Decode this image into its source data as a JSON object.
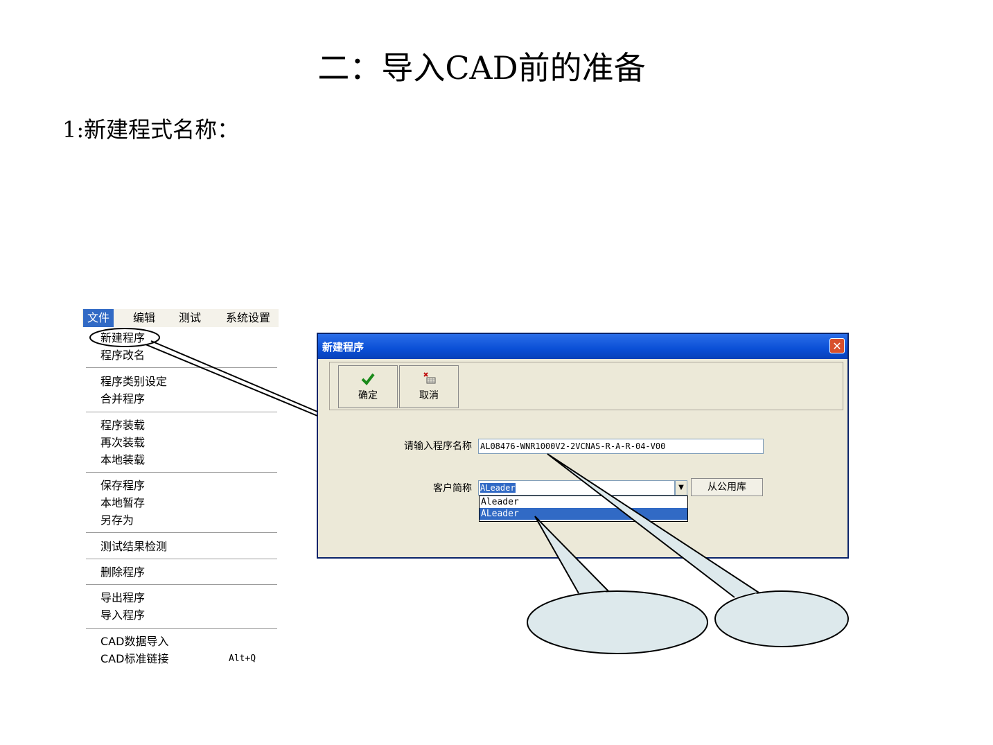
{
  "slide": {
    "title": "二：导入CAD前的准备",
    "subtitle": "1:新建程式名称："
  },
  "menu": {
    "bar": [
      "文件",
      "编辑",
      "测试",
      "系统设置"
    ],
    "active_index": 0,
    "items": [
      "新建程序",
      "程序改名",
      "程序类别设定",
      "合并程序",
      "程序装载",
      "再次装载",
      "本地装载",
      "保存程序",
      "本地暂存",
      "另存为",
      "测试结果检测",
      "删除程序",
      "导出程序",
      "导入程序",
      "CAD数据导入",
      "CAD标准链接"
    ],
    "shortcut": "Alt+Q"
  },
  "dialog": {
    "title": "新建程序",
    "close_glyph": "✕",
    "ok_label": "确定",
    "cancel_label": "取消",
    "program_name_label": "请输入程序名称",
    "program_name_value": "AL08476-WNR1000V2-2VCNAS-R-A-R-04-V00",
    "customer_label": "客户简称",
    "customer_value": "ALeader",
    "public_button": "从公用库",
    "dropdown_options": [
      "Aleader",
      "ALeader"
    ],
    "dropdown_selected_index": 1
  },
  "colors": {
    "menu_highlight": "#316ac5",
    "dialog_title": "#0a4fd6",
    "callout_fill": "#dde9ec"
  }
}
